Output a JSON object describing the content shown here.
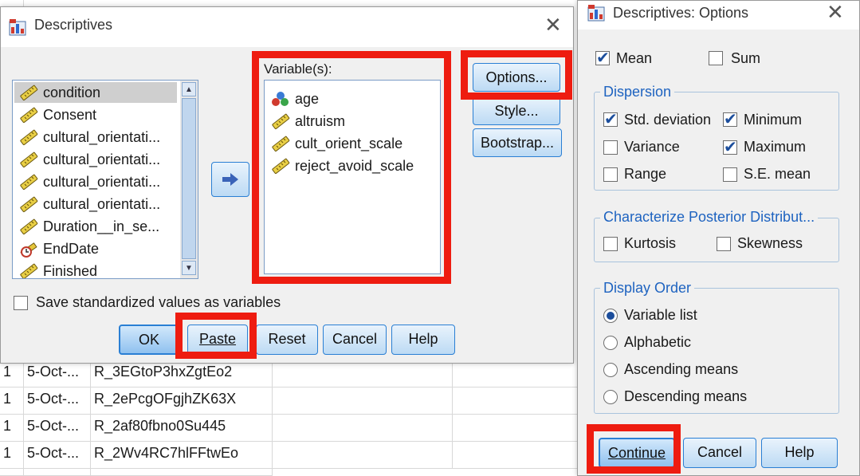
{
  "spreadsheet": {
    "rows": [
      {
        "n": "1",
        "date": "5-Oct-...",
        "id": "R_3EGtoP3hxZgtEo2"
      },
      {
        "n": "1",
        "date": "5-Oct-...",
        "id": "R_2ePcgOFgjhZK63X"
      },
      {
        "n": "1",
        "date": "5-Oct-...",
        "id": "R_2af80fbno0Su445"
      },
      {
        "n": "1",
        "date": "5-Oct-...",
        "id": "R_2Wv4RC7hlFFtwEo"
      }
    ]
  },
  "descriptives": {
    "title": "Descriptives",
    "close": "✕",
    "source_list": [
      {
        "label": "condition",
        "icon": "scale-ruler-icon",
        "selected": true
      },
      {
        "label": "Consent",
        "icon": "scale-ruler-icon"
      },
      {
        "label": "cultural_orientati...",
        "icon": "scale-ruler-icon"
      },
      {
        "label": "cultural_orientati...",
        "icon": "scale-ruler-icon"
      },
      {
        "label": "cultural_orientati...",
        "icon": "scale-ruler-icon"
      },
      {
        "label": "cultural_orientati...",
        "icon": "scale-ruler-icon"
      },
      {
        "label": "Duration__in_se...",
        "icon": "scale-ruler-icon"
      },
      {
        "label": "EndDate",
        "icon": "date-clock-icon"
      },
      {
        "label": "Finished",
        "icon": "scale-ruler-icon"
      }
    ],
    "arrow_icon": "move-right-arrow-icon",
    "variables_label": "Variable(s):",
    "variables_list": [
      {
        "label": "age",
        "icon": "nominal-balls-icon"
      },
      {
        "label": "altruism",
        "icon": "scale-ruler-icon"
      },
      {
        "label": "cult_orient_scale",
        "icon": "scale-ruler-icon"
      },
      {
        "label": "reject_avoid_scale",
        "icon": "scale-ruler-icon"
      }
    ],
    "side_buttons": {
      "options": "Options...",
      "style": "Style...",
      "bootstrap": "Bootstrap..."
    },
    "save_std_label": "Save standardized values as variables",
    "save_std_checked": false,
    "bottom_buttons": {
      "ok": "OK",
      "paste": "Paste",
      "reset": "Reset",
      "cancel": "Cancel",
      "help": "Help"
    }
  },
  "options": {
    "title": "Descriptives: Options",
    "close": "✕",
    "mean": {
      "label": "Mean",
      "checked": true
    },
    "sum": {
      "label": "Sum",
      "checked": false
    },
    "dispersion": {
      "title": "Dispersion",
      "std_dev": {
        "label": "Std. deviation",
        "checked": true
      },
      "minimum": {
        "label": "Minimum",
        "checked": true
      },
      "variance": {
        "label": "Variance",
        "checked": false
      },
      "maximum": {
        "label": "Maximum",
        "checked": true
      },
      "range": {
        "label": "Range",
        "checked": false
      },
      "se_mean": {
        "label": "S.E. mean",
        "checked": false
      }
    },
    "posterior": {
      "title": "Characterize Posterior Distribut...",
      "kurtosis": {
        "label": "Kurtosis",
        "checked": false
      },
      "skewness": {
        "label": "Skewness",
        "checked": false
      }
    },
    "display_order": {
      "title": "Display Order",
      "selected": "variable_list",
      "items": {
        "variable_list": "Variable list",
        "alphabetic": "Alphabetic",
        "ascending": "Ascending means",
        "descending": "Descending means"
      }
    },
    "buttons": {
      "continue": "Continue",
      "cancel": "Cancel",
      "help": "Help"
    }
  },
  "colors": {
    "highlight": "#ee1c10",
    "accent": "#2a7fd4",
    "group_title": "#1e63c0"
  }
}
